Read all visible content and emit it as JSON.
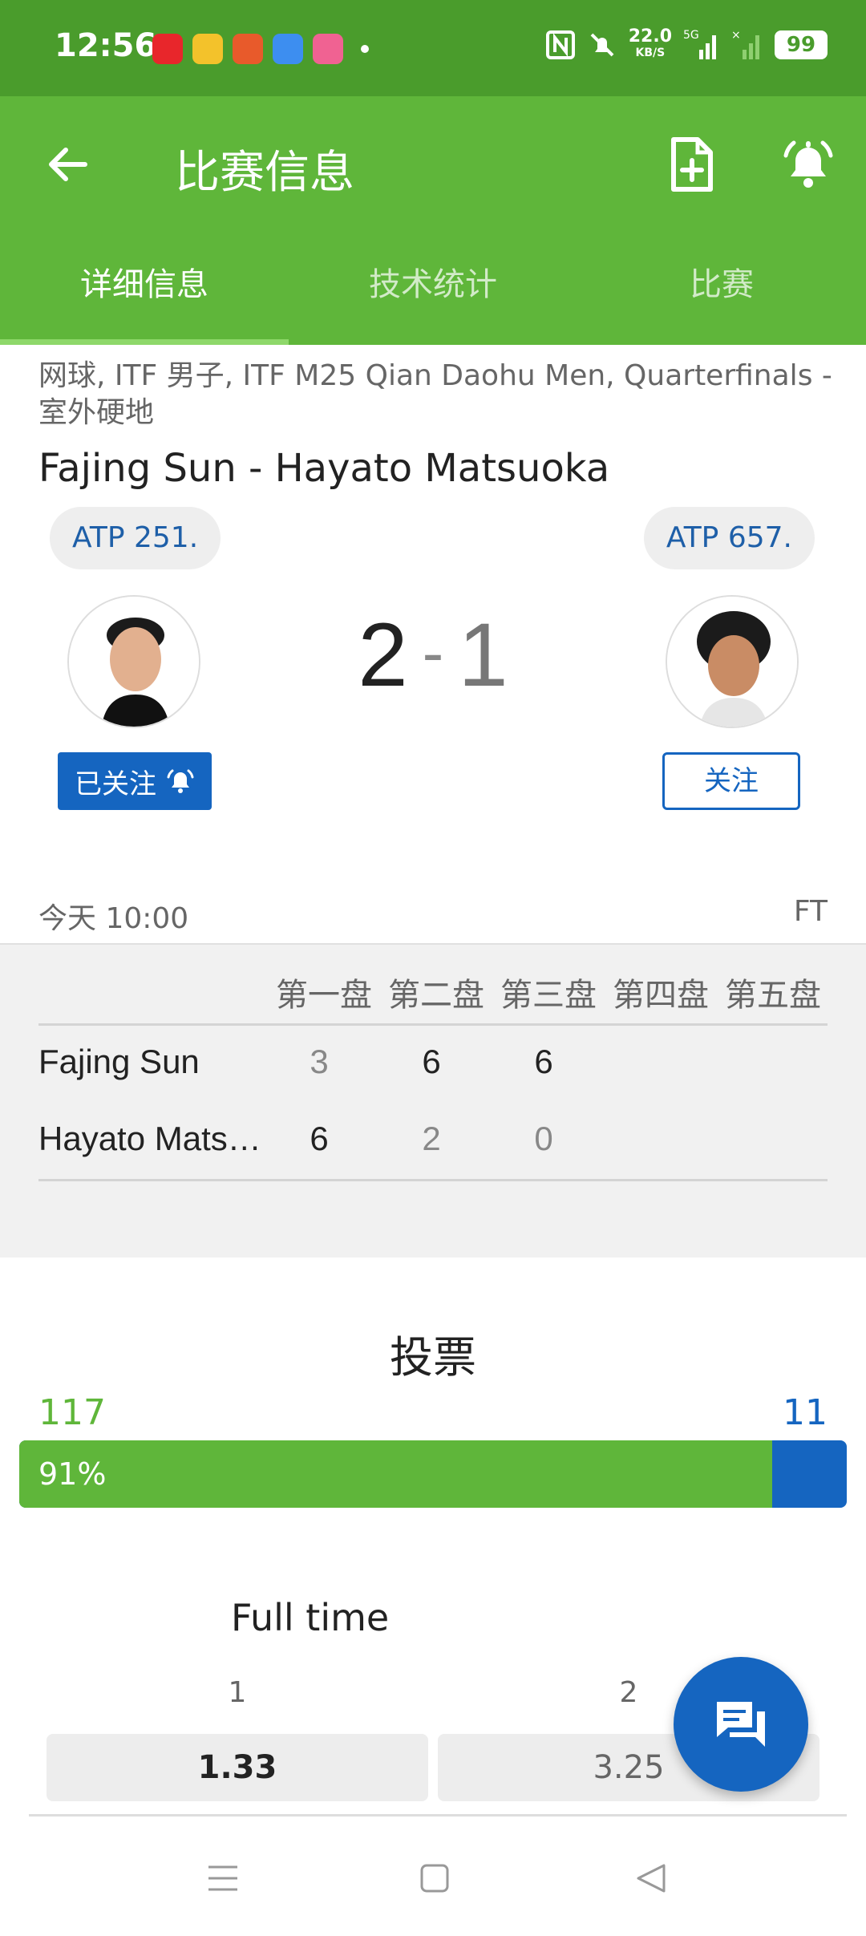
{
  "status_bar": {
    "time": "12:56",
    "net_speed": "22.0",
    "net_unit": "KB/S",
    "network": "5G",
    "battery": "99"
  },
  "app_bar": {
    "title": "比赛信息",
    "back_icon": "arrow-left-icon",
    "add_icon": "add-document-icon",
    "bell_icon": "bell-icon"
  },
  "tabs": [
    {
      "label": "详细信息",
      "active": true
    },
    {
      "label": "技术统计",
      "active": false
    },
    {
      "label": "比赛",
      "active": false
    }
  ],
  "match": {
    "meta": "网球, ITF 男子, ITF M25 Qian Daohu Men, Quarterfinals - 室外硬地",
    "title": "Fajing Sun - Hayato Matsuoka",
    "home": {
      "rank": "ATP 251.",
      "follow_label": "已关注",
      "name": "Fajing Sun"
    },
    "away": {
      "rank": "ATP 657.",
      "follow_label": "关注",
      "name": "Hayato Mats…"
    },
    "score_home": "2",
    "score_sep": "-",
    "score_away": "1",
    "date": "今天 10:00",
    "status": "FT"
  },
  "sets": {
    "headers": [
      "第一盘",
      "第二盘",
      "第三盘",
      "第四盘",
      "第五盘"
    ],
    "rows": [
      {
        "name": "Fajing Sun",
        "values": [
          "3",
          "6",
          "6"
        ]
      },
      {
        "name": "Hayato Mats…",
        "values": [
          "6",
          "2",
          "0"
        ]
      }
    ]
  },
  "vote": {
    "title": "投票",
    "home_count": "117",
    "away_count": "11",
    "home_percent_label": "91%",
    "home_fraction": 0.91
  },
  "odds": {
    "title": "Full time",
    "labels": [
      "1",
      "2"
    ],
    "values": [
      "1.33",
      "3.25"
    ]
  },
  "colors": {
    "status_bar": "#4a9c2c",
    "primary_green": "#5fb63a",
    "accent_blue": "#1565c0"
  },
  "fab_icon": "chat-icon",
  "nav_icons": [
    "menu-icon",
    "home-icon",
    "back-triangle-icon"
  ]
}
